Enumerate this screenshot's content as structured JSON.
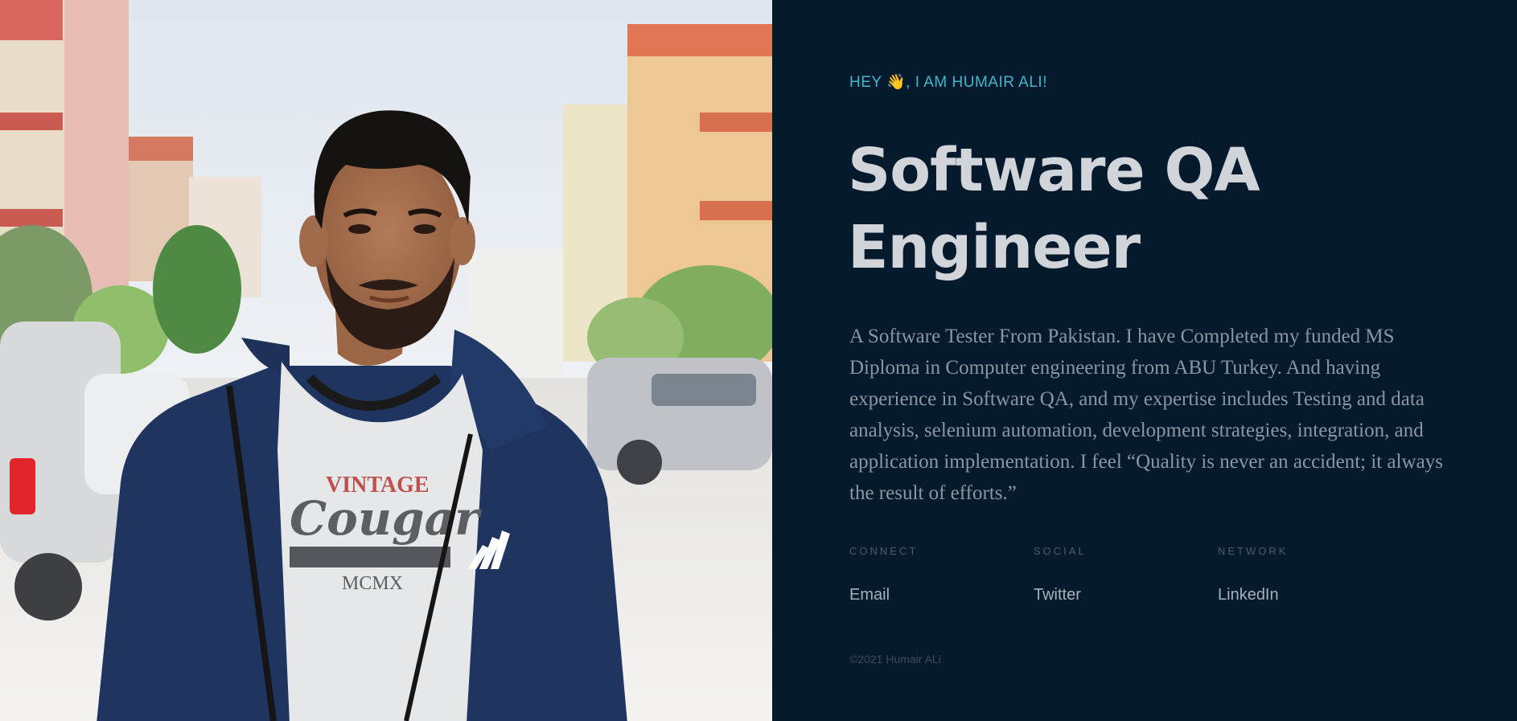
{
  "photo": {
    "description_icon": "portrait-photo",
    "logo_text": "adidas",
    "shirt_text_top": "VINTAGE",
    "shirt_text_script": "Cougar",
    "shirt_text_bottom": "MCMX"
  },
  "hero": {
    "greeting": "HEY 👋, I AM HUMAIR ALI!",
    "title_line1": "Software QA",
    "title_line2": "Engineer",
    "bio": "A Software Tester From Pakistan. I have Completed my funded MS Diploma in Computer engineering from ABU Turkey. And having experience in Software QA, and my expertise includes Testing and data analysis, selenium automation, development strategies, integration, and application implementation. I feel “Quality is never an accident; it always the result of efforts.”"
  },
  "links": {
    "connect_label": "CONNECT",
    "connect_link": "Email",
    "social_label": "SOCIAL",
    "social_link": "Twitter",
    "network_label": "NETWORK",
    "network_link": "LinkedIn"
  },
  "footer": {
    "copyright": "©2021 Humair ALi"
  },
  "colors": {
    "background": "#061a2e",
    "accent": "#3fb8c9",
    "heading": "#d1d5da",
    "body_text": "#8a96a3"
  }
}
